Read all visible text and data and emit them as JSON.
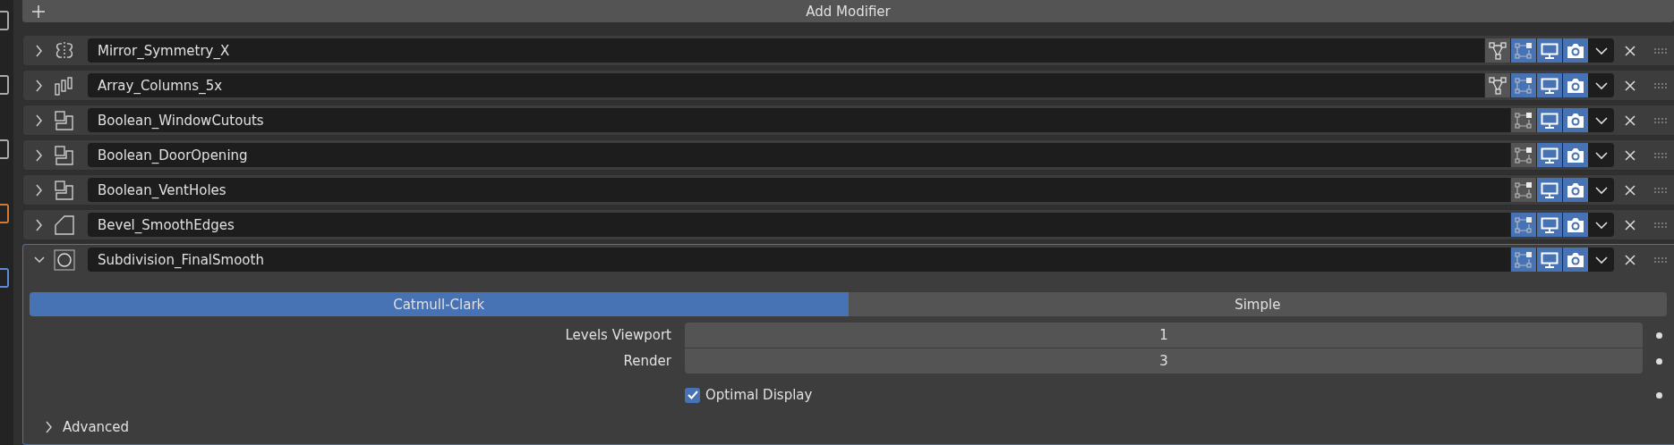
{
  "add_modifier": {
    "label": "Add Modifier"
  },
  "modifiers": [
    {
      "kind": "mirror",
      "name": "Mirror_Symmetry_X",
      "expanded": false,
      "on_cage": false,
      "edit_mode": true,
      "viewport": true,
      "render": true
    },
    {
      "kind": "array",
      "name": "Array_Columns_5x",
      "expanded": false,
      "on_cage": false,
      "edit_mode": true,
      "viewport": true,
      "render": true
    },
    {
      "kind": "boolean",
      "name": "Boolean_WindowCutouts",
      "expanded": false,
      "edit_mode": false,
      "viewport": true,
      "render": true
    },
    {
      "kind": "boolean",
      "name": "Boolean_DoorOpening",
      "expanded": false,
      "edit_mode": false,
      "viewport": true,
      "render": true
    },
    {
      "kind": "boolean",
      "name": "Boolean_VentHoles",
      "expanded": false,
      "edit_mode": false,
      "viewport": true,
      "render": true
    },
    {
      "kind": "bevel",
      "name": "Bevel_SmoothEdges",
      "expanded": false,
      "edit_mode": true,
      "viewport": true,
      "render": true
    },
    {
      "kind": "subdivision",
      "name": "Subdivision_FinalSmooth",
      "expanded": true,
      "edit_mode": true,
      "viewport": true,
      "render": true
    }
  ],
  "subdivision_panel": {
    "tabs": [
      {
        "label": "Catmull-Clark",
        "selected": true
      },
      {
        "label": "Simple",
        "selected": false
      }
    ],
    "fields": [
      {
        "label": "Levels Viewport",
        "value": "1"
      },
      {
        "label": "Render",
        "value": "3"
      }
    ],
    "optimal_display": {
      "label": "Optimal Display",
      "checked": true
    },
    "advanced": {
      "label": "Advanced",
      "expanded": false
    }
  }
}
